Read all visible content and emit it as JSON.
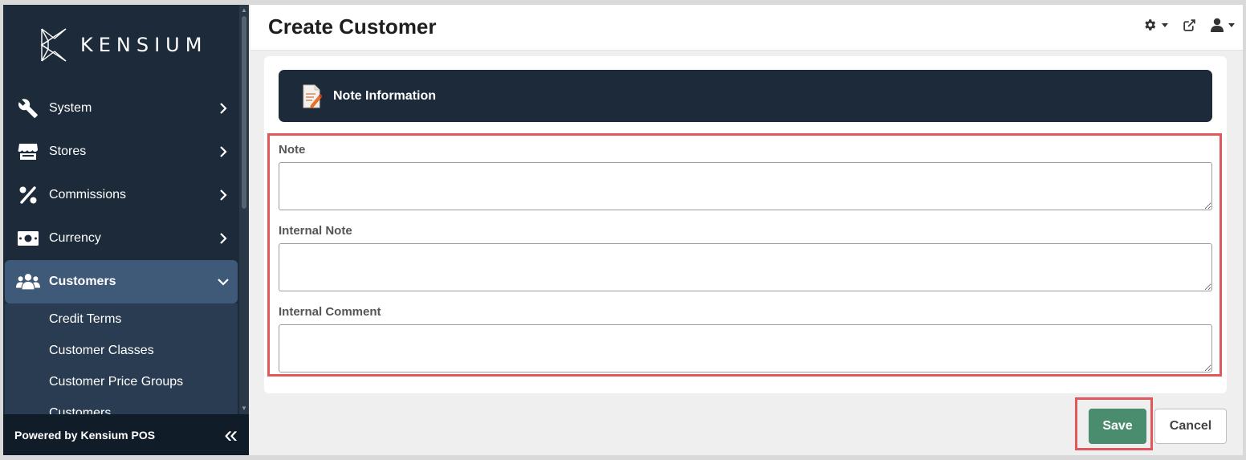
{
  "sidebar": {
    "brand": "KENSIUM",
    "items": [
      {
        "label": "System",
        "icon": "wrench-icon"
      },
      {
        "label": "Stores",
        "icon": "store-icon"
      },
      {
        "label": "Commissions",
        "icon": "percent-icon"
      },
      {
        "label": "Currency",
        "icon": "money-bill-icon"
      },
      {
        "label": "Customers",
        "icon": "users-icon",
        "active": true
      }
    ],
    "sub_items": [
      "Credit Terms",
      "Customer Classes",
      "Customer Price Groups",
      "Customers"
    ],
    "powered_by": "Powered by Kensium POS",
    "collapse_glyph": "«"
  },
  "header": {
    "title": "Create Customer"
  },
  "section": {
    "title": "Note Information"
  },
  "form": {
    "note_label": "Note",
    "note_value": "",
    "internal_note_label": "Internal Note",
    "internal_note_value": "",
    "internal_comment_label": "Internal Comment",
    "internal_comment_value": ""
  },
  "actions": {
    "save_label": "Save",
    "cancel_label": "Cancel"
  },
  "colors": {
    "sidebar_bg": "#1c2a3a",
    "active_item_bg": "#3e5a78",
    "save_green": "#4a8c6e",
    "highlight_red": "#e0585c"
  }
}
